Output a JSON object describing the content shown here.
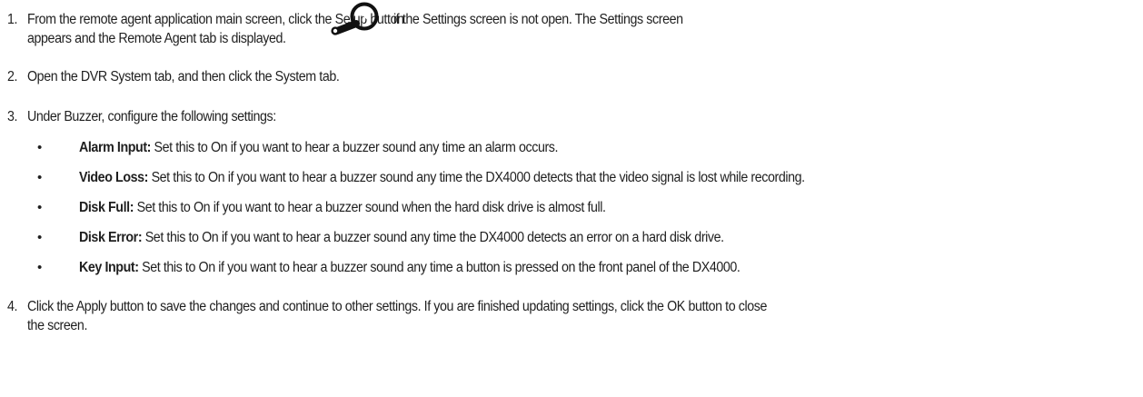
{
  "steps": [
    {
      "number": "1.",
      "text_before_icon": "From the remote agent application main screen, click the Setup button",
      "text_after_icon": "if the Settings screen is not open. The Settings screen",
      "text_line2": "appears and the Remote Agent tab is displayed.",
      "icon": "setup-wrench-icon"
    },
    {
      "number": "2.",
      "text": "Open the DVR System tab, and then click the System tab."
    },
    {
      "number": "3.",
      "text": "Under Buzzer, configure the following settings:",
      "bullets": [
        {
          "label": "Alarm Input:",
          "text": " Set this to On if you want to hear a buzzer sound any time an alarm occurs."
        },
        {
          "label": "Video Loss:",
          "text": " Set this to On if you want to hear a buzzer sound any time the DX4000 detects that the video signal is lost while recording."
        },
        {
          "label": "Disk Full:",
          "text": " Set this to On if you want to hear a buzzer sound when the hard disk drive is almost full."
        },
        {
          "label": "Disk Error:",
          "text": " Set this to On if you want to hear a buzzer sound any time the DX4000 detects an error on a hard disk drive."
        },
        {
          "label": "Key Input:",
          "text": " Set this to On if you want to hear a buzzer sound any time a button is pressed on the front panel of the DX4000."
        }
      ]
    },
    {
      "number": "4.",
      "text_line1": "Click the Apply button to save the changes and continue to other settings. If you are finished updating settings, click the OK button to close",
      "text_line2": "the screen."
    }
  ],
  "bullet_char": "•"
}
